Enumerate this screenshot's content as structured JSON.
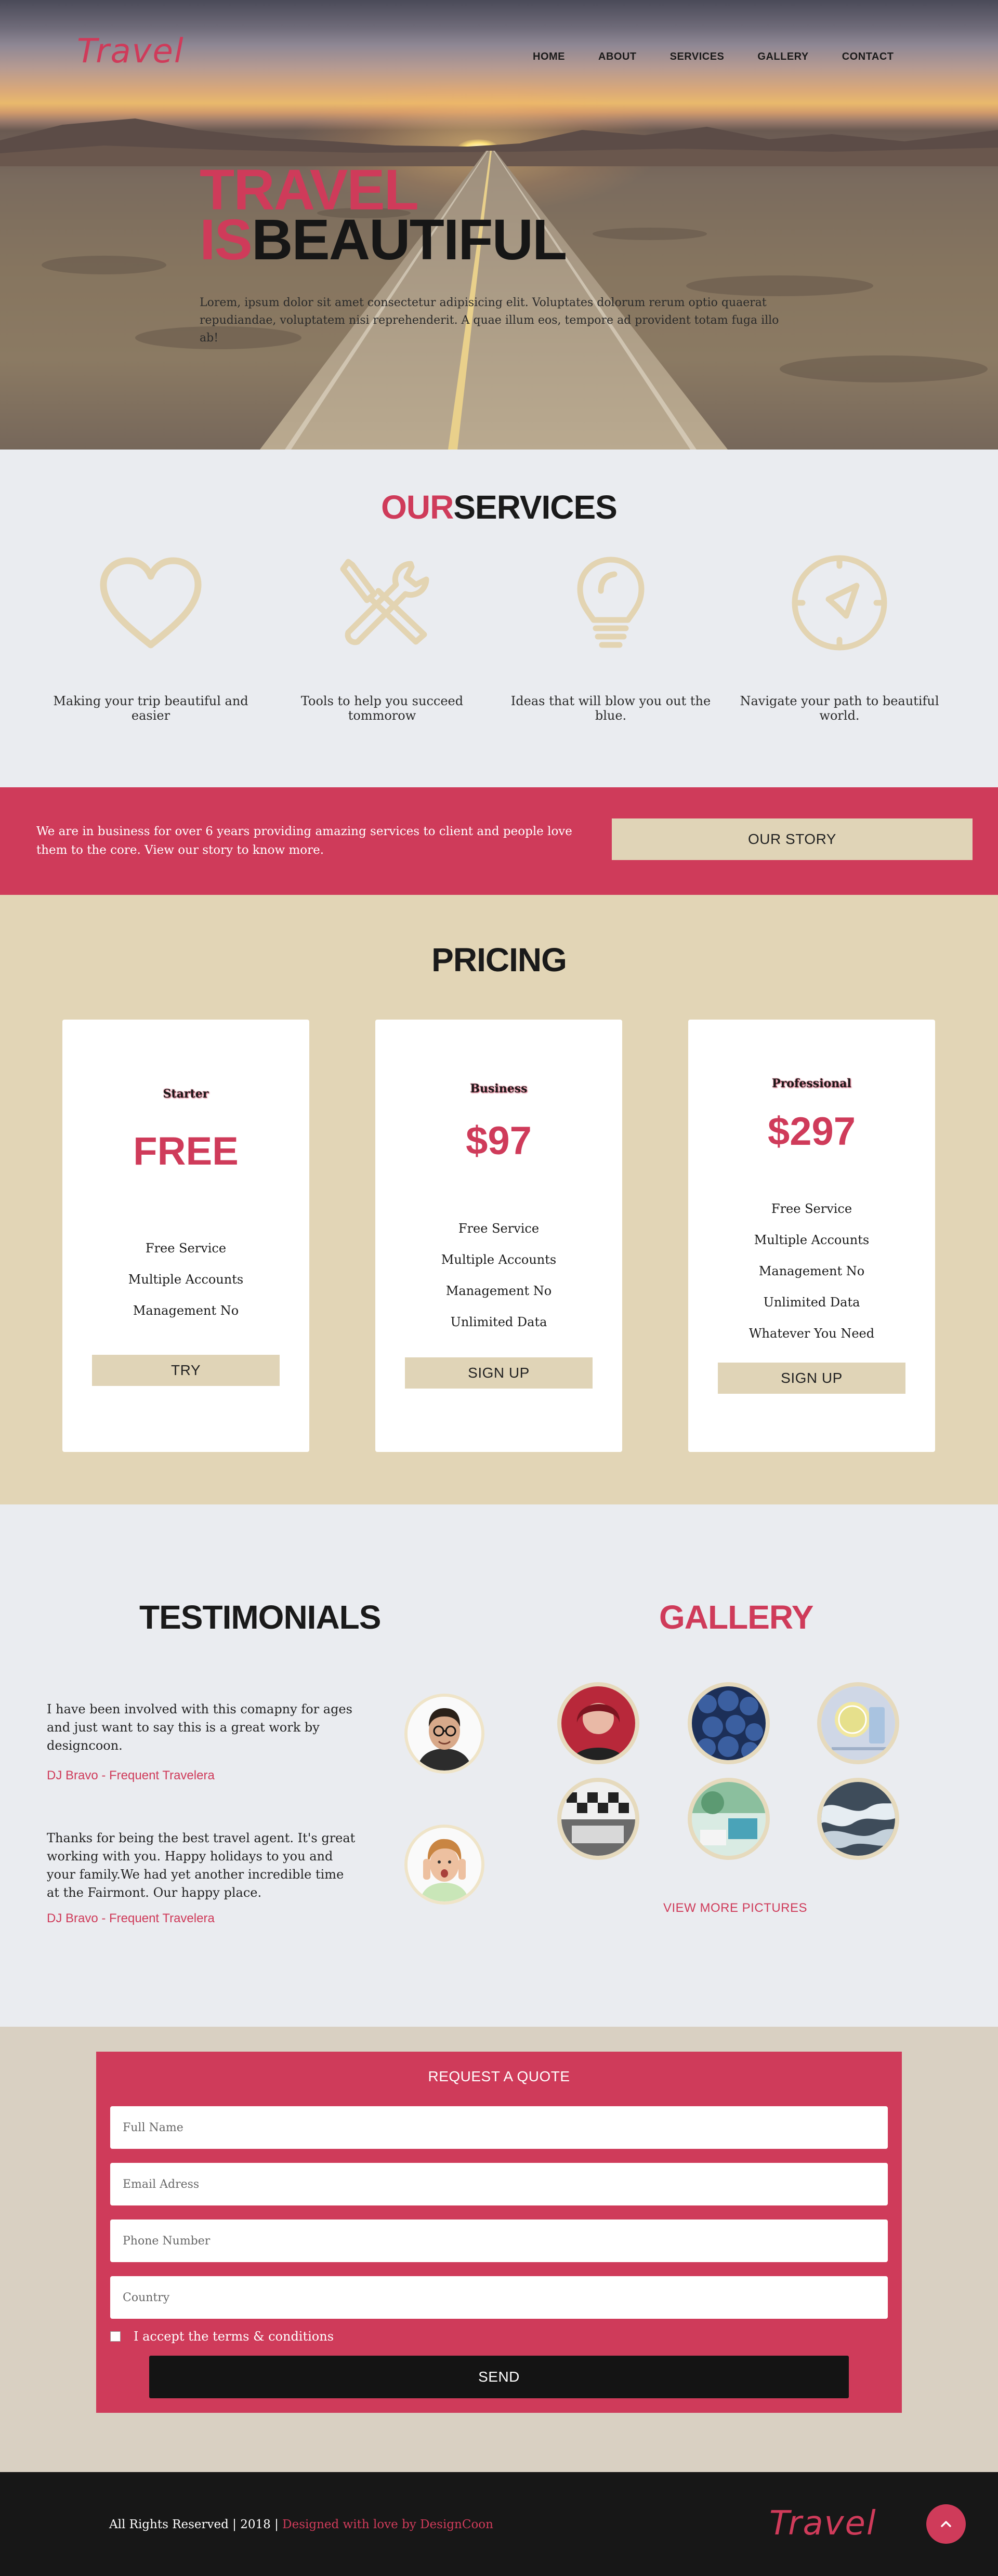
{
  "brand": {
    "logo_text": "Travel",
    "accent_color": "#cf3b5a",
    "beige_color": "#e2d5b6",
    "dark_color": "#171717"
  },
  "nav": {
    "items": [
      "HOME",
      "ABOUT",
      "SERVICES",
      "GALLERY",
      "CONTACT"
    ]
  },
  "hero": {
    "title_line1": "TRAVEL",
    "title_line2_accent": "IS",
    "title_line2_rest": "BEAUTIFUL",
    "lead": "Lorem, ipsum dolor sit amet consectetur adipisicing elit. Voluptates dolorum rerum optio quaerat repudiandae, voluptatem nisi reprehenderit. A quae illum eos, tempore ad provident totam fuga illo ab!"
  },
  "services": {
    "title_accent": "OUR",
    "title_rest": "SERVICES",
    "items": [
      {
        "icon": "heart-icon",
        "text": "Making your trip beautiful and easier"
      },
      {
        "icon": "tools-icon",
        "text": "Tools to help you succeed tommorow"
      },
      {
        "icon": "lightbulb-icon",
        "text": "Ideas that will blow you out the blue."
      },
      {
        "icon": "compass-icon",
        "text": "Navigate your path to beautiful world."
      }
    ]
  },
  "story": {
    "text": "We are in business for over 6 years providing amazing services to client and people love them to the core. View our story to know more.",
    "button_label": "OUR STORY"
  },
  "pricing": {
    "title": "PRICING",
    "plans": [
      {
        "name": "Starter",
        "price": "FREE",
        "features": [
          "Free Service",
          "Multiple Accounts",
          "Management No"
        ],
        "button_label": "TRY"
      },
      {
        "name": "Business",
        "price": "$97",
        "features": [
          "Free Service",
          "Multiple Accounts",
          "Management No",
          "Unlimited Data"
        ],
        "button_label": "SIGN UP"
      },
      {
        "name": "Professional",
        "price": "$297",
        "features": [
          "Free Service",
          "Multiple Accounts",
          "Management No",
          "Unlimited Data",
          "Whatever You Need"
        ],
        "button_label": "SIGN UP"
      }
    ]
  },
  "testimonials": {
    "title": "TESTIMONIALS",
    "items": [
      {
        "quote": "I have been involved with this comapny for ages and just want to say this is a great work by designcoon.",
        "author": "DJ Bravo - Frequent Travelera"
      },
      {
        "quote": "Thanks for being the best travel agent. It's great working with you. Happy holidays to you and your family.We had yet another incredible time at the Fairmont. Our happy place.",
        "author": "DJ Bravo - Frequent Travelera"
      }
    ]
  },
  "gallery": {
    "title": "GALLERY",
    "view_more": "VIEW MORE PICTURES"
  },
  "quote_form": {
    "title": "REQUEST A QUOTE",
    "fields": [
      "Full Name",
      "Email Adress",
      "Phone Number",
      "Country"
    ],
    "terms_label": "I accept the terms & conditions",
    "send_label": "SEND"
  },
  "footer": {
    "copyright": "All Rights Reserved | 2018 |",
    "credit": "Designed with love by DesignCoon",
    "logo_text": "Travel",
    "to_top_icon": "chevron-up-icon"
  }
}
